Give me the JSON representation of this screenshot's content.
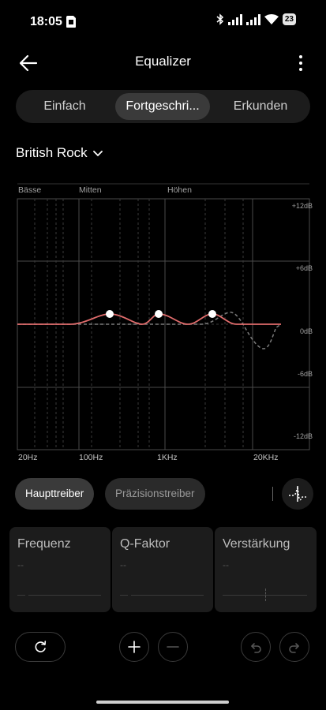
{
  "status": {
    "time": "18:05",
    "battery": "23",
    "icons": [
      "sim-card-icon",
      "bluetooth-icon",
      "signal-icon",
      "signal-icon",
      "wifi-icon",
      "battery-icon"
    ]
  },
  "header": {
    "title": "Equalizer",
    "back_icon": "back-arrow-icon",
    "more_icon": "more-vertical-icon"
  },
  "tabs": [
    {
      "label": "Einfach",
      "active": false
    },
    {
      "label": "Fortgeschri...",
      "active": true
    },
    {
      "label": "Erkunden",
      "active": false
    }
  ],
  "preset": {
    "name": "British Rock",
    "icon": "chevron-down-icon"
  },
  "chart_data": {
    "type": "line",
    "bands": [
      "Bässe",
      "Mitten",
      "Höhen"
    ],
    "x_ticks": [
      "20Hz",
      "100Hz",
      "1KHz",
      "20KHz"
    ],
    "y_ticks": [
      "+12dB",
      "+6dB",
      "0dB",
      "-6dB",
      "-12dB"
    ],
    "ylim": [
      -12,
      12
    ],
    "x_scale": "log",
    "series": [
      {
        "color": "#e06c6c",
        "style": "solid",
        "control_points": [
          [
            200,
            1
          ],
          [
            800,
            1
          ],
          [
            3000,
            1
          ]
        ]
      },
      {
        "color": "#7a7a7a",
        "style": "dashed"
      }
    ]
  },
  "drivers": {
    "main": "Haupttreiber",
    "precision": "Präzisionstreiber",
    "toggle_icon": "curve-toggle-icon"
  },
  "params": [
    {
      "label": "Frequenz",
      "value": "--"
    },
    {
      "label": "Q-Faktor",
      "value": "--"
    },
    {
      "label": "Verstärkung",
      "value": "--"
    }
  ],
  "actions": {
    "reset_icon": "reset-icon",
    "add_icon": "plus-icon",
    "remove_icon": "minus-icon",
    "undo_icon": "undo-icon",
    "redo_icon": "redo-icon"
  }
}
